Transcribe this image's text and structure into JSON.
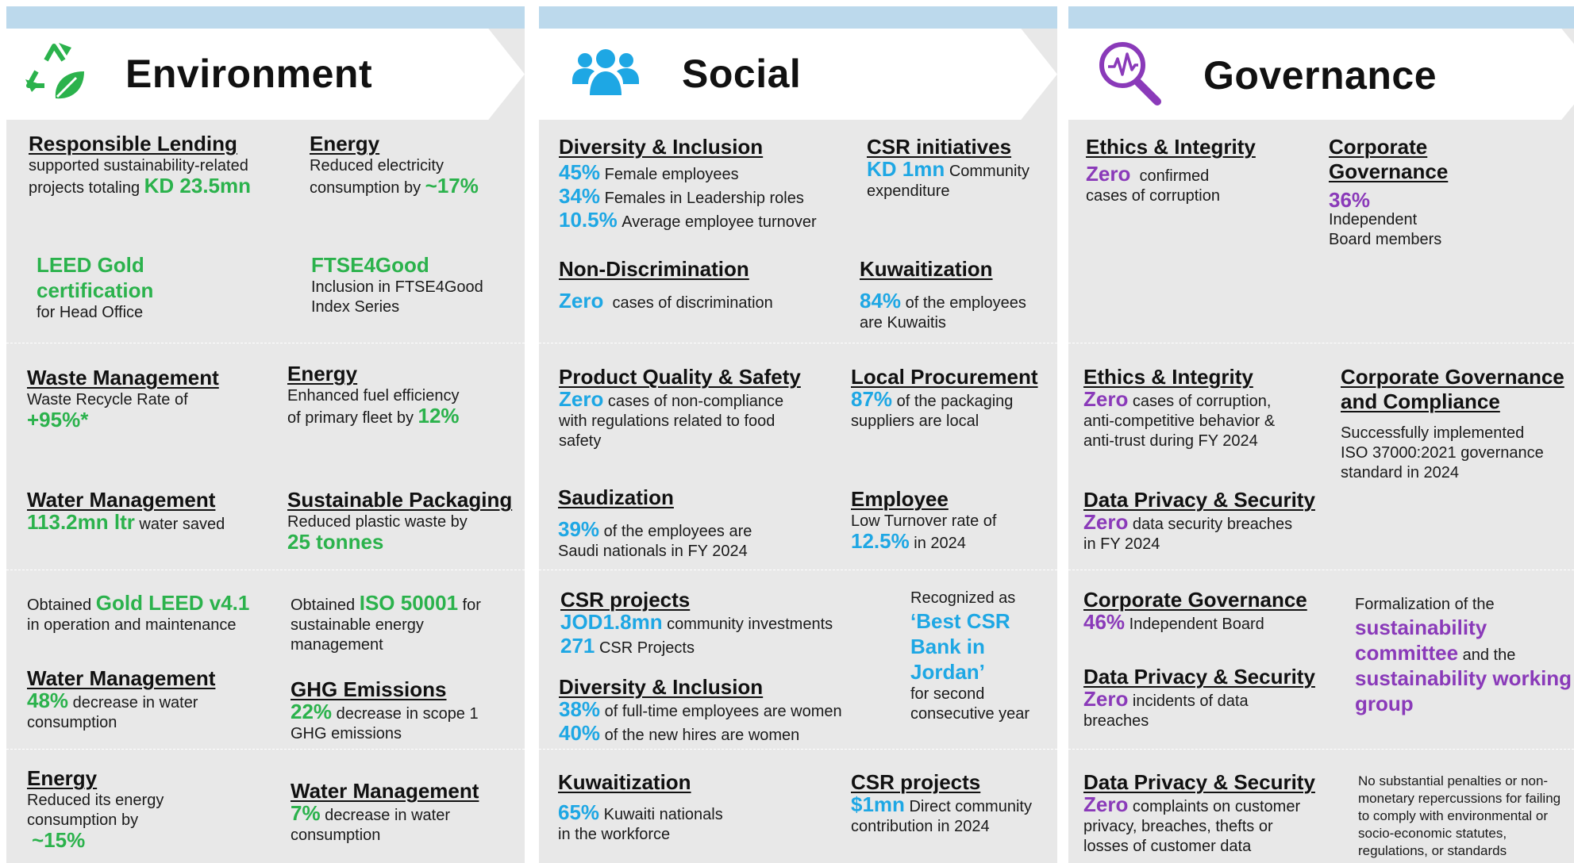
{
  "environment": {
    "title": "Environment",
    "icon": "recycle-leaf-icon",
    "accent": "#2bb24c",
    "blocks": {
      "resp_lending": {
        "heading": "Responsible Lending",
        "l1": "supported sustainability-related",
        "l2": "projects totaling",
        "value": "KD 23.5mn"
      },
      "energy1": {
        "heading": "Energy",
        "l1": "Reduced electricity",
        "l2": "consumption by",
        "value": "~17%"
      },
      "leed": {
        "v1": "LEED Gold",
        "v2": "certification",
        "l1": "for Head Office"
      },
      "ftse": {
        "value": "FTSE4Good",
        "l1": "Inclusion in FTSE4Good",
        "l2": "Index Series"
      },
      "waste": {
        "heading": "Waste Management",
        "l1": "Waste Recycle Rate of",
        "value": "+95%*"
      },
      "energy2": {
        "heading": "Energy",
        "l1": "Enhanced fuel efficiency",
        "l2": "of primary fleet by",
        "value": "12%"
      },
      "water1": {
        "heading": "Water Management",
        "value": "113.2mn ltr",
        "l1": "water saved"
      },
      "packaging": {
        "heading": "Sustainable Packaging",
        "l1": "Reduced plastic waste by",
        "value": "25 tonnes"
      },
      "gold_leed": {
        "pre": "Obtained",
        "value": "Gold LEED v4.1",
        "l1": "in operation and maintenance"
      },
      "iso": {
        "pre": "Obtained",
        "value": "ISO 50001",
        "post": "for",
        "l1": "sustainable energy",
        "l2": "management"
      },
      "water2": {
        "heading": "Water Management",
        "value": "48%",
        "l1": "decrease in water",
        "l2": "consumption"
      },
      "ghg": {
        "heading": "GHG Emissions",
        "value": "22%",
        "l1": "decrease in scope 1",
        "l2": "GHG emissions"
      },
      "energy3": {
        "heading": "Energy",
        "l1": "Reduced its energy",
        "l2": "consumption by",
        "value": "~15%"
      },
      "water3": {
        "heading": "Water Management",
        "value": "7%",
        "l1": "decrease in water",
        "l2": "consumption"
      }
    }
  },
  "social": {
    "title": "Social",
    "icon": "people-group-icon",
    "accent": "#1ea7e4",
    "blocks": {
      "diversity1": {
        "heading": "Diversity & Inclusion",
        "r1v": "45%",
        "r1t": "Female employees",
        "r2v": "34%",
        "r2t": "Females in Leadership roles",
        "r3v": "10.5%",
        "r3t": "Average employee turnover"
      },
      "csr_init": {
        "heading": "CSR initiatives",
        "value": "KD 1mn",
        "l1": "Community",
        "l2": "expenditure"
      },
      "nondisc": {
        "heading": "Non-Discrimination",
        "value": "Zero",
        "l1": "cases of discrimination"
      },
      "kuwaitization1": {
        "heading": "Kuwaitization",
        "value": "84%",
        "l1": "of the employees",
        "l2": "are Kuwaitis"
      },
      "quality": {
        "heading": "Product Quality & Safety",
        "value": "Zero",
        "l1": "cases of non-compliance",
        "l2": "with regulations related to food",
        "l3": "safety"
      },
      "procurement": {
        "heading": "Local Procurement",
        "value": "87%",
        "l1": "of the packaging",
        "l2": "suppliers are local"
      },
      "saudization": {
        "heading": "Saudization",
        "value": "39%",
        "l1": "of the employees are",
        "l2": "Saudi nationals in FY 2024"
      },
      "employee": {
        "heading": "Employee",
        "l1": "Low Turnover rate of",
        "value": "12.5%",
        "l2": "in 2024"
      },
      "csr_proj1": {
        "heading": "CSR projects",
        "r1v": "JOD1.8mn",
        "r1t": "community investments",
        "r2v": "271",
        "r2t": "CSR Projects"
      },
      "best_csr": {
        "l1": "Recognized as",
        "v1": "‘Best CSR",
        "v2": "Bank in",
        "v3": "Jordan’",
        "l2": "for second",
        "l3": "consecutive year"
      },
      "diversity2": {
        "heading": "Diversity & Inclusion",
        "r1v": "38%",
        "r1t": "of full-time employees are women",
        "r2v": "40%",
        "r2t": "of the new hires are women"
      },
      "kuwaitization2": {
        "heading": "Kuwaitization",
        "value": "65%",
        "l1": "Kuwaiti nationals",
        "l2": "in the workforce"
      },
      "csr_proj2": {
        "heading": "CSR projects",
        "value": "$1mn",
        "l1": "Direct community",
        "l2": "contribution in 2024"
      }
    }
  },
  "governance": {
    "title": "Governance",
    "icon": "magnifier-pulse-icon",
    "accent": "#8a3ab9",
    "blocks": {
      "ethics1": {
        "heading": "Ethics & Integrity",
        "value": "Zero",
        "l1": "confirmed",
        "l2": "cases of corruption"
      },
      "corp_gov1": {
        "h1": "Corporate",
        "h2": "Governance",
        "value": "36%",
        "l1": "Independent",
        "l2": "Board members"
      },
      "ethics2": {
        "heading": "Ethics & Integrity",
        "value": "Zero",
        "l1": "cases of corruption,",
        "l2": "anti-competitive behavior &",
        "l3": "anti-trust during FY 2024"
      },
      "corp_gov_comp": {
        "h1": "Corporate Governance",
        "h2": "and Compliance",
        "l1": "Successfully implemented",
        "l2": "ISO 37000:2021 governance",
        "l3": "standard in 2024"
      },
      "privacy1": {
        "heading": "Data Privacy & Security",
        "value": "Zero",
        "l1": "data security breaches",
        "l2": "in FY 2024"
      },
      "corp_gov2": {
        "heading": "Corporate Governance",
        "value": "46%",
        "l1": "Independent Board"
      },
      "formalization": {
        "l1": "Formalization of the",
        "v1": "sustainability",
        "v2": "committee",
        "l2": "and the",
        "v3": "sustainability working",
        "v4": "group"
      },
      "privacy2": {
        "heading": "Data Privacy & Security",
        "value": "Zero",
        "l1": "incidents of data",
        "l2": "breaches"
      },
      "privacy3": {
        "heading": "Data Privacy & Security",
        "value": "Zero",
        "l1": "complaints on customer",
        "l2": "privacy, breaches, thefts or",
        "l3": "losses of customer data"
      },
      "penalties": {
        "l1": "No substantial penalties or non-",
        "l2": "monetary repercussions for failing",
        "l3": "to comply with environmental or",
        "l4": "socio-economic statutes,",
        "l5": "regulations, or standards"
      }
    }
  }
}
